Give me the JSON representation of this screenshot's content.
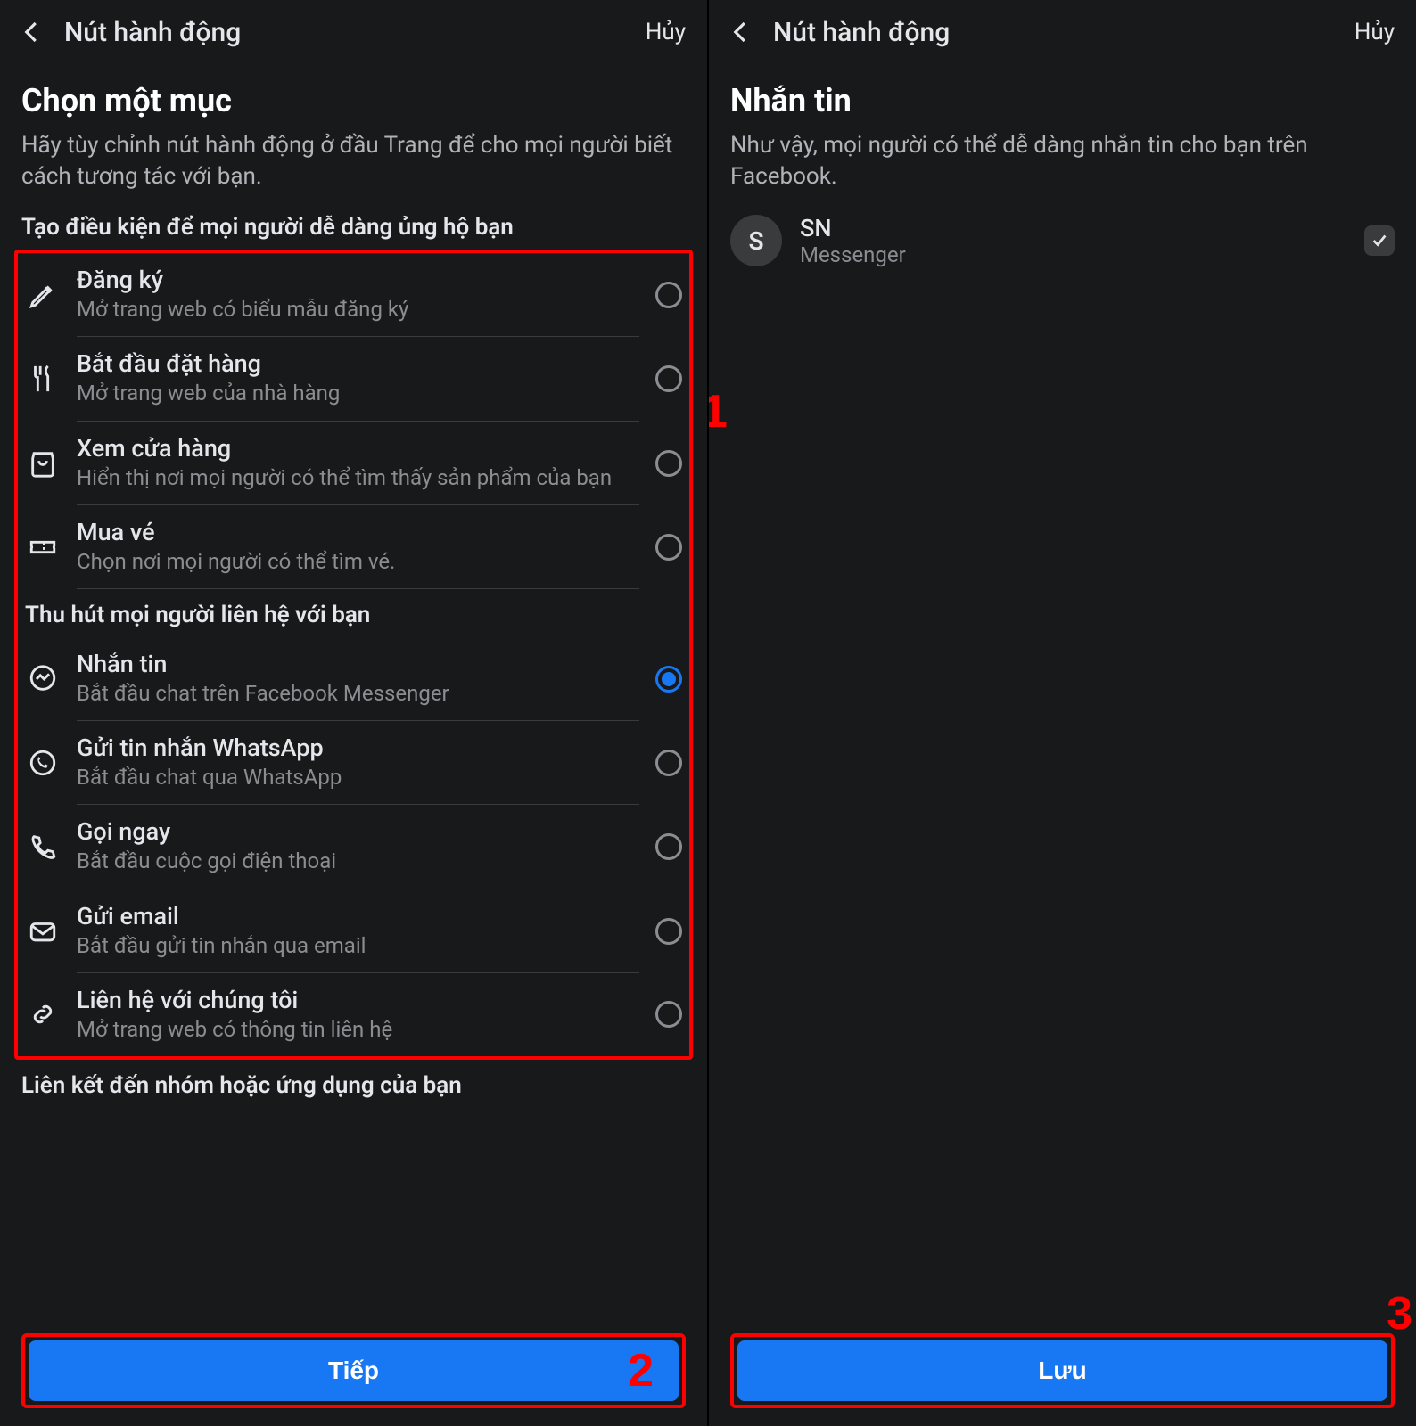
{
  "left": {
    "topbar": {
      "title": "Nút hành động",
      "cancel": "Hủy"
    },
    "pageTitle": "Chọn một mục",
    "pageSub": "Hãy tùy chỉnh nút hành động ở đầu Trang để cho mọi người biết cách tương tác với bạn.",
    "section1": "Tạo điều kiện để mọi người dễ dàng ủng hộ bạn",
    "options1": [
      {
        "icon": "pencil",
        "title": "Đăng ký",
        "desc": "Mở trang web có biểu mẫu đăng ký",
        "selected": false
      },
      {
        "icon": "fork",
        "title": "Bắt đầu đặt hàng",
        "desc": "Mở trang web của nhà hàng",
        "selected": false
      },
      {
        "icon": "bag",
        "title": "Xem cửa hàng",
        "desc": "Hiển thị nơi mọi người có thể tìm thấy sản phẩm của bạn",
        "selected": false
      },
      {
        "icon": "ticket",
        "title": "Mua vé",
        "desc": "Chọn nơi mọi người có thể tìm vé.",
        "selected": false
      }
    ],
    "section2": "Thu hút mọi người liên hệ với bạn",
    "options2": [
      {
        "icon": "messenger",
        "title": "Nhắn tin",
        "desc": "Bắt đầu chat trên Facebook Messenger",
        "selected": true
      },
      {
        "icon": "whatsapp",
        "title": "Gửi tin nhắn WhatsApp",
        "desc": "Bắt đầu chat qua WhatsApp",
        "selected": false
      },
      {
        "icon": "phone",
        "title": "Gọi ngay",
        "desc": "Bắt đầu cuộc gọi điện thoại",
        "selected": false
      },
      {
        "icon": "mail",
        "title": "Gửi email",
        "desc": "Bắt đầu gửi tin nhắn qua email",
        "selected": false
      },
      {
        "icon": "link",
        "title": "Liên hệ với chúng tôi",
        "desc": "Mở trang web có thông tin liên hệ",
        "selected": false
      }
    ],
    "section3": "Liên kết đến nhóm hoặc ứng dụng của bạn",
    "nextBtn": "Tiếp"
  },
  "right": {
    "topbar": {
      "title": "Nút hành động",
      "cancel": "Hủy"
    },
    "pageTitle": "Nhắn tin",
    "pageSub": "Như vậy, mọi người có thể dễ dàng nhắn tin cho bạn trên Facebook.",
    "messenger": {
      "avatar": "S",
      "name": "SN",
      "platform": "Messenger"
    },
    "saveBtn": "Lưu"
  },
  "annotations": {
    "a1": "1",
    "a2": "2",
    "a3": "3"
  }
}
